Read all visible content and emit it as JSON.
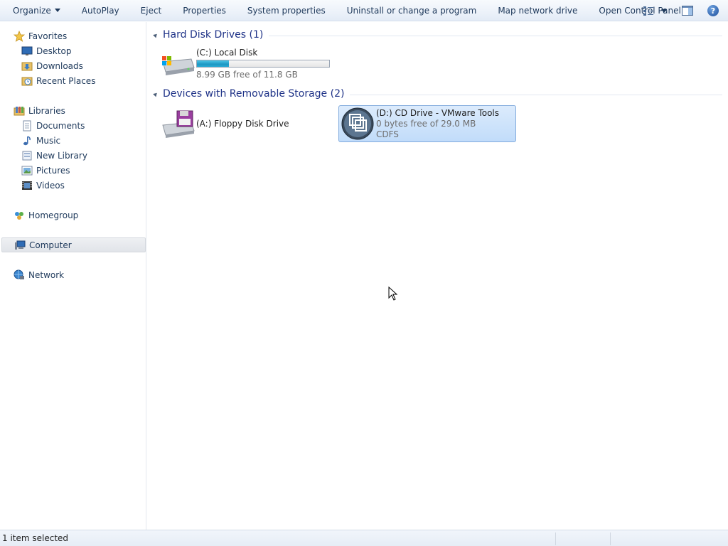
{
  "toolbar": {
    "organize": "Organize",
    "autoplay": "AutoPlay",
    "eject": "Eject",
    "properties": "Properties",
    "system_properties": "System properties",
    "uninstall": "Uninstall or change a program",
    "map_drive": "Map network drive",
    "control_panel": "Open Control Panel",
    "icons": [
      "view-options-icon",
      "chevron-down-icon",
      "preview-pane-icon",
      "help-icon"
    ],
    "help_glyph": "?"
  },
  "sidebar": {
    "favorites": {
      "label": "Favorites",
      "icon": "star-icon"
    },
    "favorites_items": [
      {
        "label": "Desktop",
        "icon": "desktop-icon"
      },
      {
        "label": "Downloads",
        "icon": "downloads-folder-icon"
      },
      {
        "label": "Recent Places",
        "icon": "recent-places-icon"
      }
    ],
    "libraries": {
      "label": "Libraries",
      "icon": "libraries-icon"
    },
    "libraries_items": [
      {
        "label": "Documents",
        "icon": "documents-icon"
      },
      {
        "label": "Music",
        "icon": "music-icon"
      },
      {
        "label": "New Library",
        "icon": "library-icon"
      },
      {
        "label": "Pictures",
        "icon": "pictures-icon"
      },
      {
        "label": "Videos",
        "icon": "videos-icon"
      }
    ],
    "homegroup": {
      "label": "Homegroup",
      "icon": "homegroup-icon"
    },
    "computer": {
      "label": "Computer",
      "icon": "computer-icon",
      "selected": true
    },
    "network": {
      "label": "Network",
      "icon": "network-icon"
    }
  },
  "content": {
    "groups": [
      {
        "label": "Hard Disk Drives (1)"
      },
      {
        "label": "Devices with Removable Storage (2)"
      }
    ],
    "drives": {
      "c": {
        "name": "(C:) Local Disk",
        "free_text": "8.99 GB free of 11.8 GB",
        "used_fraction": 0.24,
        "icon": "hard-disk-icon"
      },
      "a": {
        "name": "(A:) Floppy Disk Drive",
        "icon": "floppy-drive-icon"
      },
      "d": {
        "name": "(D:) CD Drive - VMware Tools",
        "free_text": "0 bytes free of 29.0 MB",
        "filesystem": "CDFS",
        "icon": "vmware-cd-icon",
        "selected": true
      }
    }
  },
  "statusbar": {
    "text": "1 item selected"
  },
  "colors": {
    "accent": "#1e3287",
    "selection": "#c1dcfa",
    "bar_fill": "#1d97c3"
  }
}
